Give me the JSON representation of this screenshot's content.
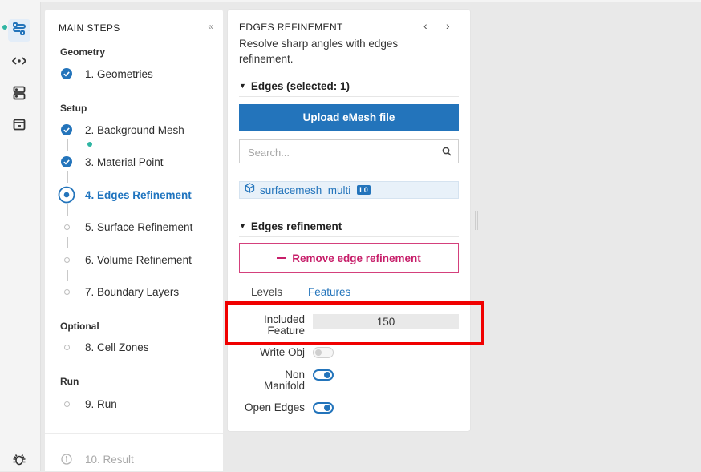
{
  "rail": {
    "icons": [
      "workflow-icon",
      "code-brackets-icon",
      "database-icon",
      "monitor-icon",
      "bug-icon"
    ]
  },
  "steps_panel": {
    "title": "MAIN STEPS",
    "collapse": "«",
    "groups": {
      "geometry": "Geometry",
      "setup": "Setup",
      "optional": "Optional",
      "run": "Run"
    },
    "steps": [
      {
        "label": "1. Geometries",
        "status": "done"
      },
      {
        "label": "2. Background Mesh",
        "status": "done"
      },
      {
        "label": "3. Material Point",
        "status": "done"
      },
      {
        "label": "4. Edges Refinement",
        "status": "active"
      },
      {
        "label": "5. Surface Refinement",
        "status": "pending"
      },
      {
        "label": "6. Volume Refinement",
        "status": "pending"
      },
      {
        "label": "7. Boundary Layers",
        "status": "pending"
      },
      {
        "label": "8. Cell Zones",
        "status": "pending"
      },
      {
        "label": "9. Run",
        "status": "pending"
      },
      {
        "label": "10. Result",
        "status": "disabled"
      }
    ]
  },
  "edges_panel": {
    "title": "EDGES REFINEMENT",
    "prev": "‹",
    "next": "›",
    "description": "Resolve sharp angles with edges refinement.",
    "edges_section": "Edges (selected: 1)",
    "upload_button": "Upload eMesh file",
    "search_placeholder": "Search...",
    "selected_item": {
      "name": "surfacemesh_multi",
      "badge": "L0"
    },
    "refinement_section": "Edges refinement",
    "remove_button": "Remove edge refinement",
    "tabs": {
      "levels": "Levels",
      "features": "Features",
      "active": "Features"
    },
    "fields": {
      "included_feature_label_1": "Included",
      "included_feature_label_2": "Feature",
      "included_feature_value": "150",
      "write_obj_label": "Write Obj",
      "write_obj_on": false,
      "non_manifold_label_1": "Non",
      "non_manifold_label_2": "Manifold",
      "non_manifold_on": true,
      "open_edges_label": "Open Edges",
      "open_edges_on": true
    }
  },
  "colors": {
    "accent_blue": "#2374bb",
    "remove_pink": "#c71f6a",
    "status_green": "#2fb5a3",
    "highlight_red": "#f00000"
  }
}
